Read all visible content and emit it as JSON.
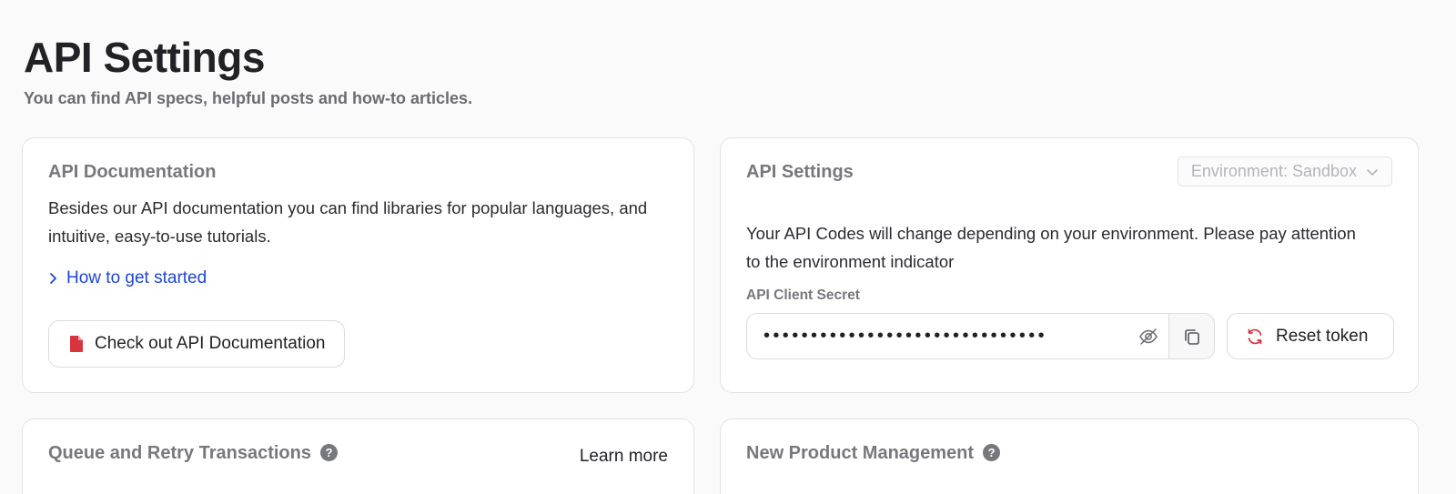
{
  "header": {
    "title": "API Settings",
    "subtitle": "You can find API specs, helpful posts and how-to articles."
  },
  "doc_card": {
    "title": "API Documentation",
    "description": "Besides our API documentation you can find libraries for popular languages, and intuitive, easy-to-use tutorials.",
    "link_label": "How to get started",
    "button_label": "Check out API Documentation"
  },
  "settings_card": {
    "title": "API Settings",
    "environment_select": "Environment: Sandbox",
    "description": "Your API Codes will change depending on your environment. Please pay attention to the environment indicator",
    "secret_label": "API Client Secret",
    "secret_value": "••••••••••••••••••••••••••••••",
    "reset_label": "Reset token"
  },
  "queue_card": {
    "title": "Queue and Retry Transactions",
    "help": "?",
    "learn_more": "Learn more"
  },
  "product_card": {
    "title": "New Product Management",
    "help": "?"
  },
  "colors": {
    "link": "#1d46d6",
    "doc_icon": "#d9333f",
    "reset_icon": "#d9333f"
  }
}
